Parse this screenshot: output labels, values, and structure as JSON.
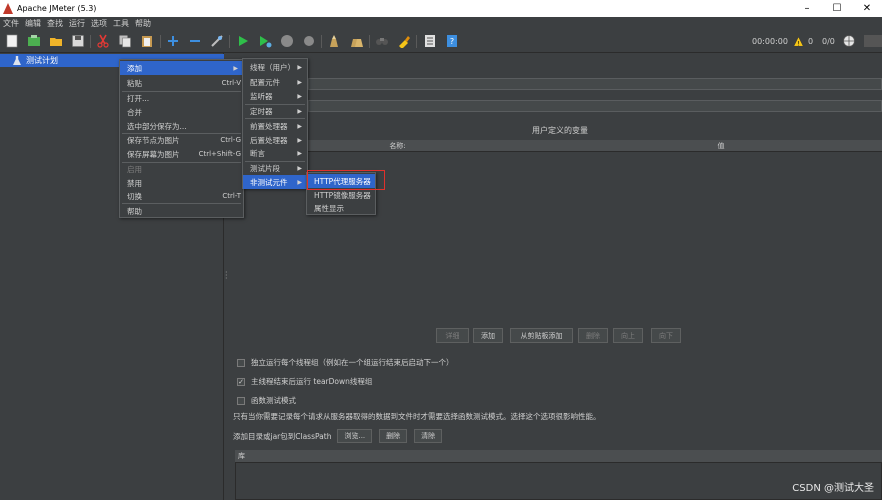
{
  "window": {
    "title": "Apache JMeter (5.3)",
    "min": "–",
    "max": "☐",
    "close": "✕"
  },
  "menubar": [
    "文件",
    "编辑",
    "查找",
    "运行",
    "选项",
    "工具",
    "帮助"
  ],
  "toolbar": {
    "timer": "00:00:00",
    "warn_count": "0",
    "thread_count": "0/0"
  },
  "tree": {
    "root_label": "测试计划"
  },
  "test_plan": {
    "variables_title": "用户定义的变量",
    "columns": {
      "name": "名称:",
      "value": "值"
    },
    "buttons": {
      "detail": "详细",
      "add": "添加",
      "add_clipboard": "从剪贴板添加",
      "delete": "删除",
      "up": "向上",
      "down": "向下"
    },
    "options": [
      {
        "label": "独立运行每个线程组（例如在一个组运行结束后启动下一个）",
        "checked": false
      },
      {
        "label": "主线程结束后运行 tearDown线程组",
        "checked": true
      },
      {
        "label": "函数测试模式",
        "checked": false
      }
    ],
    "note": "只有当你需要记录每个请求从服务器取得的数据到文件时才需要选择函数测试模式。选择这个选项很影响性能。",
    "classpath": {
      "label": "添加目录或jar包到ClassPath",
      "browse": "浏览...",
      "delete": "删除",
      "clear": "清除"
    },
    "lib_header": "库"
  },
  "context_menu": {
    "items": [
      {
        "label": "添加",
        "arrow": "▶",
        "highlighted": true
      },
      {
        "label": "粘贴",
        "shortcut": "Ctrl-V"
      },
      {
        "label": "打开..."
      },
      {
        "label": "合并"
      },
      {
        "label": "选中部分保存为..."
      },
      {
        "label": "保存节点为图片",
        "shortcut": "Ctrl-G"
      },
      {
        "label": "保存屏幕为图片",
        "shortcut": "Ctrl+Shift-G"
      },
      {
        "label": "启用",
        "disabled": true
      },
      {
        "label": "禁用"
      },
      {
        "label": "切换",
        "shortcut": "Ctrl-T"
      },
      {
        "label": "帮助"
      }
    ]
  },
  "add_submenu": {
    "items": [
      {
        "label": "线程（用户）",
        "arrow": "▶"
      },
      {
        "label": "配置元件",
        "arrow": "▶"
      },
      {
        "label": "监听器",
        "arrow": "▶"
      },
      {
        "label": "定时器",
        "arrow": "▶"
      },
      {
        "label": "前置处理器",
        "arrow": "▶"
      },
      {
        "label": "后置处理器",
        "arrow": "▶"
      },
      {
        "label": "断言",
        "arrow": "▶"
      },
      {
        "label": "测试片段",
        "arrow": "▶"
      },
      {
        "label": "非测试元件",
        "arrow": "▶",
        "highlighted": true
      }
    ]
  },
  "nontest_submenu": {
    "items": [
      {
        "label": "HTTP代理服务器",
        "highlighted": true
      },
      {
        "label": "HTTP镜像服务器"
      },
      {
        "label": "属性显示"
      }
    ]
  },
  "watermark": "CSDN @测试大圣",
  "colors": {
    "selection": "#2f65ca",
    "annotation_box": "#e0312c",
    "background": "#3c3f41"
  }
}
